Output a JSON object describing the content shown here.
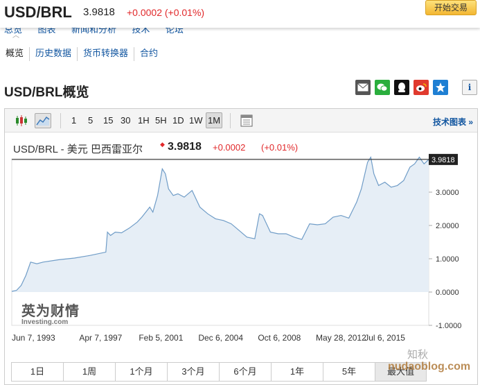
{
  "header": {
    "pair": "USD/BRL",
    "price": "3.9818",
    "change": "+0.0002 (+0.01%)",
    "trade_button": "开始交易",
    "hidden_nav": [
      "总览",
      "图表",
      "新闻和分析",
      "技术",
      "论坛"
    ]
  },
  "subnav": [
    "概览",
    "历史数据",
    "货币转换器",
    "合约"
  ],
  "section_title": "USD/BRL概览",
  "share_icons": [
    "mail-icon",
    "wechat-icon",
    "qq-icon",
    "weibo-icon",
    "qzone-icon",
    "info-icon"
  ],
  "toolbar": {
    "periods": [
      "1",
      "5",
      "15",
      "30",
      "1H",
      "5H",
      "1D",
      "1W",
      "1M"
    ],
    "active_period": "1M",
    "tech_link": "技术图表 »"
  },
  "chart_header": {
    "title": "USD/BRL - 美元 巴西雷亚尔",
    "price": "3.9818",
    "change": "+0.0002",
    "percent": "(+0.01%)"
  },
  "watermark": {
    "cn": "英为财情",
    "en": "Investing.com"
  },
  "range_buttons": [
    "1日",
    "1周",
    "1个月",
    "3个月",
    "6个月",
    "1年",
    "5年",
    "最大值"
  ],
  "active_range": "最大值",
  "site_watermark": "nudaoblog.com",
  "site_watermark2": "知秋",
  "colors": {
    "accent": "#1256a0",
    "positive": "#e1282a",
    "line": "#6f9cc7",
    "area": "#e6eef6"
  },
  "chart_data": {
    "type": "area",
    "title": "USD/BRL - 美元 巴西雷亚尔",
    "x_tick_labels": [
      "Jun 7, 1993",
      "Apr 7, 1997",
      "Feb 5, 2001",
      "Dec 6, 2004",
      "Oct 6, 2008",
      "May 28, 2012",
      "Jul 6, 2015"
    ],
    "y_tick_labels": [
      "-1.0000",
      "0.0000",
      "1.0000",
      "2.0000",
      "3.0000"
    ],
    "ylim": [
      -1.0,
      4.0
    ],
    "last_value": 3.9818,
    "last_value_label": "3.9818",
    "series": [
      {
        "x": [
          1993.0,
          1993.3,
          1993.6,
          1993.9,
          1994.2,
          1994.6,
          1995.0,
          1996.0,
          1997.0,
          1998.0,
          1999.0,
          1999.1,
          1999.3,
          1999.6,
          2000.0,
          2000.5,
          2001.0,
          2001.3,
          2001.8,
          2002.0,
          2002.3,
          2002.6,
          2002.8,
          2003.0,
          2003.3,
          2003.6,
          2004.0,
          2004.5,
          2005.0,
          2005.5,
          2006.0,
          2006.5,
          2007.0,
          2007.5,
          2008.0,
          2008.5,
          2008.8,
          2009.0,
          2009.5,
          2010.0,
          2010.5,
          2011.0,
          2011.5,
          2012.0,
          2012.5,
          2013.0,
          2013.5,
          2014.0,
          2014.5,
          2015.0,
          2015.3,
          2015.7,
          2015.9,
          2016.1,
          2016.4,
          2016.8,
          2017.2,
          2017.6,
          2018.0,
          2018.4,
          2018.7,
          2019.0,
          2019.3,
          2019.6
        ],
        "y": [
          0.02,
          0.05,
          0.2,
          0.5,
          0.9,
          0.85,
          0.9,
          0.97,
          1.02,
          1.1,
          1.2,
          1.8,
          1.7,
          1.8,
          1.78,
          1.92,
          2.1,
          2.25,
          2.55,
          2.4,
          2.9,
          3.7,
          3.55,
          3.1,
          2.9,
          2.95,
          2.85,
          3.05,
          2.55,
          2.35,
          2.2,
          2.15,
          2.05,
          1.85,
          1.65,
          1.6,
          2.35,
          2.3,
          1.8,
          1.75,
          1.75,
          1.65,
          1.58,
          2.05,
          2.02,
          2.05,
          2.25,
          2.3,
          2.22,
          2.7,
          3.1,
          3.9,
          4.05,
          3.55,
          3.2,
          3.3,
          3.15,
          3.2,
          3.35,
          3.75,
          3.85,
          4.05,
          3.85,
          3.98
        ]
      }
    ]
  }
}
